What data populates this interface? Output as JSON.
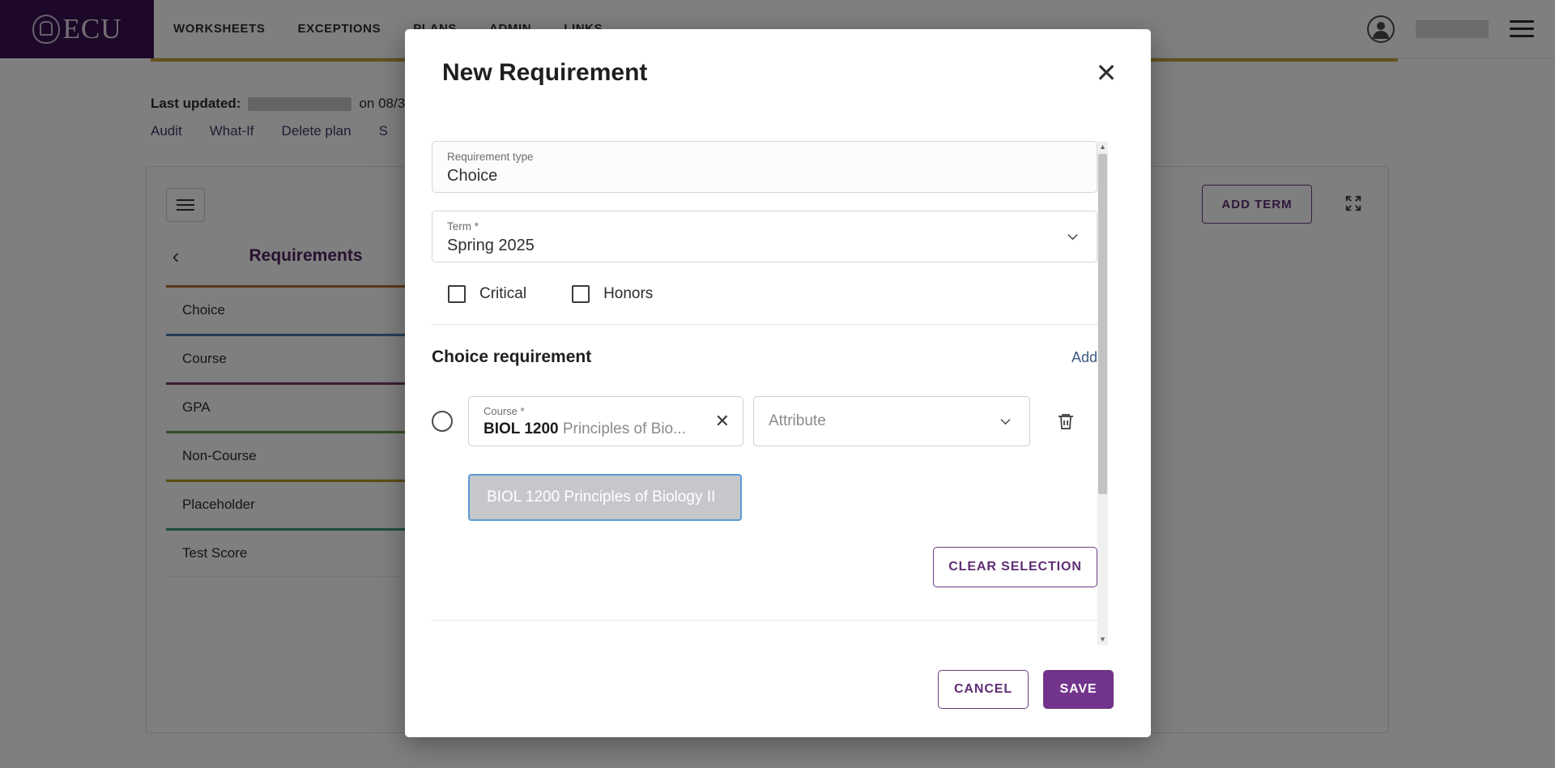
{
  "nav": {
    "brand": "ECU",
    "links": [
      "WORKSHEETS",
      "EXCEPTIONS",
      "PLANS",
      "ADMIN",
      "LINKS"
    ]
  },
  "plan": {
    "last_updated_label": "Last updated:",
    "last_updated_on": "on 08/3",
    "links": [
      "Audit",
      "What-If",
      "Delete plan",
      "S"
    ]
  },
  "toolbar": {
    "add_term_label": "ADD TERM"
  },
  "requirements_panel": {
    "title": "Requirements",
    "back_icon": "‹",
    "items": [
      {
        "label": "Choice",
        "value": "-",
        "color": "#b5722c"
      },
      {
        "label": "Course",
        "value": "-",
        "color": "#4a7fb5"
      },
      {
        "label": "GPA",
        "value": "-",
        "color": "#7b3f6d"
      },
      {
        "label": "Non-Course",
        "value": "-",
        "color": "#6d9e4b"
      },
      {
        "label": "Placeholder",
        "value": "-",
        "color": "#b59a28"
      },
      {
        "label": "Test Score",
        "value": "-",
        "color": "#3f9b87"
      }
    ]
  },
  "modal": {
    "title": "New Requirement",
    "close_icon": "✕",
    "requirement_type": {
      "label": "Requirement type",
      "value": "Choice"
    },
    "term": {
      "label": "Term *",
      "value": "Spring 2025"
    },
    "checkboxes": [
      {
        "label": "Critical",
        "checked": false
      },
      {
        "label": "Honors",
        "checked": false
      }
    ],
    "section": {
      "title": "Choice requirement",
      "add_label": "Add"
    },
    "choice_row": {
      "course_label": "Course *",
      "course_code": "BIOL 1200",
      "course_title": "Principles of Bio...",
      "clear_icon": "✕",
      "attribute_placeholder": "Attribute"
    },
    "suggestion": {
      "text": "BIOL 1200 Principles of Biology II"
    },
    "clear_selection_label": "CLEAR SELECTION",
    "footer": {
      "cancel_label": "CANCEL",
      "save_label": "SAVE"
    }
  },
  "colors": {
    "brand_purple": "#3b1152",
    "accent_purple": "#72348c",
    "link_blue": "#3d5a80",
    "gold": "#c6a23a",
    "suggestion_border": "#5b9bd5"
  }
}
